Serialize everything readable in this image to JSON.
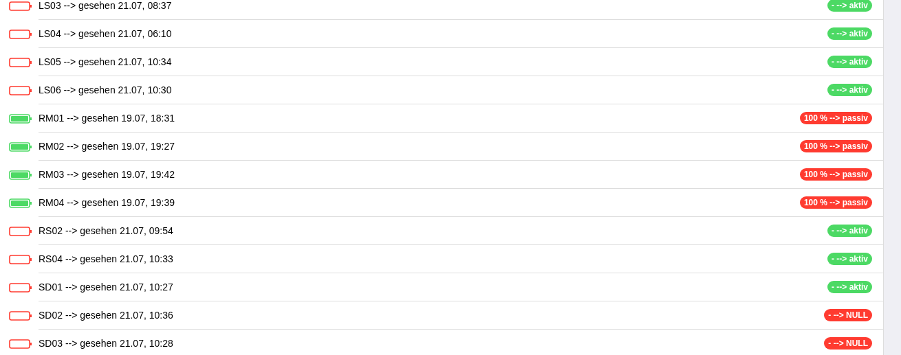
{
  "devices": [
    {
      "label": "LS03 --> gesehen 21.07, 08:37",
      "battery": {
        "charged": false
      },
      "status": {
        "text": "- --> aktiv",
        "color": "#4cd964"
      }
    },
    {
      "label": "LS04 --> gesehen 21.07, 06:10",
      "battery": {
        "charged": false
      },
      "status": {
        "text": "- --> aktiv",
        "color": "#4cd964"
      }
    },
    {
      "label": "LS05 --> gesehen 21.07, 10:34",
      "battery": {
        "charged": false
      },
      "status": {
        "text": "- --> aktiv",
        "color": "#4cd964"
      }
    },
    {
      "label": "LS06 --> gesehen 21.07, 10:30",
      "battery": {
        "charged": false
      },
      "status": {
        "text": "- --> aktiv",
        "color": "#4cd964"
      }
    },
    {
      "label": "RM01 --> gesehen 19.07, 18:31",
      "battery": {
        "charged": true
      },
      "status": {
        "text": "100 % --> passiv",
        "color": "#ff3b30"
      }
    },
    {
      "label": "RM02 --> gesehen 19.07, 19:27",
      "battery": {
        "charged": true
      },
      "status": {
        "text": "100 % --> passiv",
        "color": "#ff3b30"
      }
    },
    {
      "label": "RM03 --> gesehen 19.07, 19:42",
      "battery": {
        "charged": true
      },
      "status": {
        "text": "100 % --> passiv",
        "color": "#ff3b30"
      }
    },
    {
      "label": "RM04 --> gesehen 19.07, 19:39",
      "battery": {
        "charged": true
      },
      "status": {
        "text": "100 % --> passiv",
        "color": "#ff3b30"
      }
    },
    {
      "label": "RS02 --> gesehen 21.07, 09:54",
      "battery": {
        "charged": false
      },
      "status": {
        "text": "- --> aktiv",
        "color": "#4cd964"
      }
    },
    {
      "label": "RS04 --> gesehen 21.07, 10:33",
      "battery": {
        "charged": false
      },
      "status": {
        "text": "- --> aktiv",
        "color": "#4cd964"
      }
    },
    {
      "label": "SD01 --> gesehen 21.07, 10:27",
      "battery": {
        "charged": false
      },
      "status": {
        "text": "- --> aktiv",
        "color": "#4cd964"
      }
    },
    {
      "label": "SD02 --> gesehen 21.07, 10:36",
      "battery": {
        "charged": false
      },
      "status": {
        "text": "- --> NULL",
        "color": "#ff3b30"
      }
    },
    {
      "label": "SD03 --> gesehen 21.07, 10:28",
      "battery": {
        "charged": false
      },
      "status": {
        "text": "- --> NULL",
        "color": "#ff3b30"
      }
    }
  ]
}
